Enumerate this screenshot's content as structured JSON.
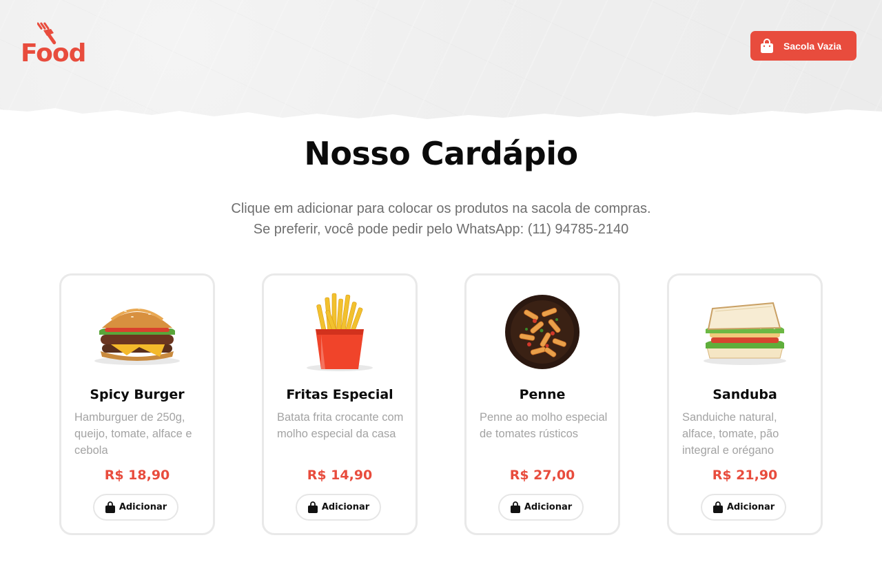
{
  "brand": {
    "logo_text": "Food",
    "accent_color": "#e84c3d"
  },
  "header": {
    "bag_button_label": "Sacola Vazia",
    "bag_icon": "shopping-bag-icon"
  },
  "main": {
    "title": "Nosso Cardápio",
    "subtitle_line1": "Clique em adicionar para colocar os produtos na sacola de compras.",
    "subtitle_line2": "Se preferir, você pode pedir pelo WhatsApp: (11) 94785-2140"
  },
  "products": [
    {
      "name": "Spicy Burger",
      "description": "Hamburguer de 250g, queijo, tomate, alface e cebola",
      "price": "R$ 18,90",
      "button_label": "Adicionar",
      "image": "burger-image"
    },
    {
      "name": "Fritas Especial",
      "description": "Batata frita crocante com molho especial da casa",
      "price": "R$ 14,90",
      "button_label": "Adicionar",
      "image": "fries-image"
    },
    {
      "name": "Penne",
      "description": "Penne ao molho especial de tomates rústicos",
      "price": "R$ 27,00",
      "button_label": "Adicionar",
      "image": "penne-image"
    },
    {
      "name": "Sanduba",
      "description": "Sanduiche natural, alface, tomate, pão integral e orégano",
      "price": "R$ 21,90",
      "button_label": "Adicionar",
      "image": "sandwich-image"
    }
  ]
}
